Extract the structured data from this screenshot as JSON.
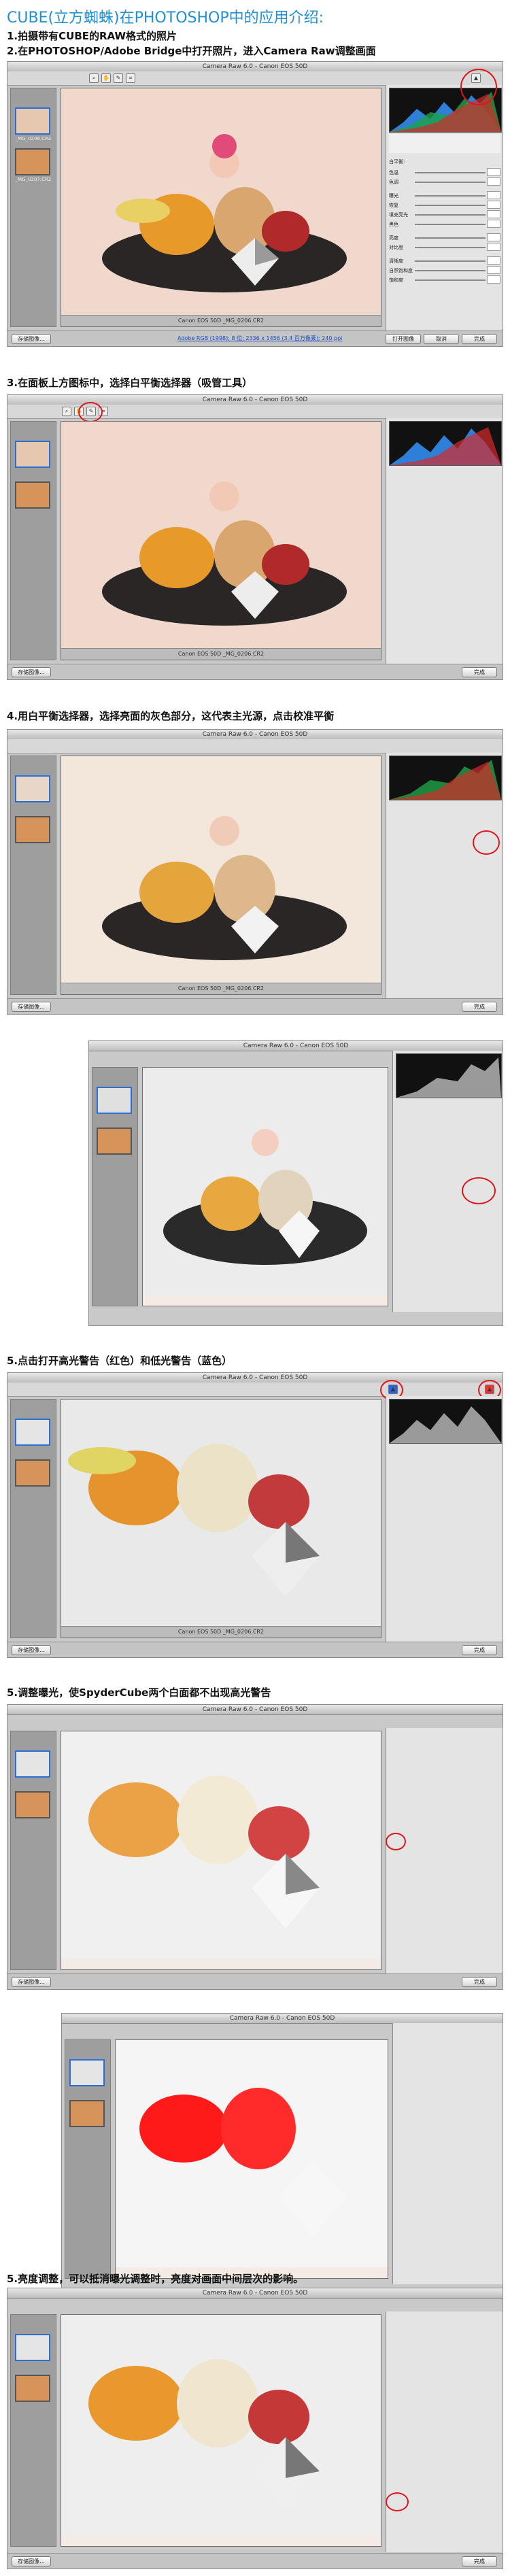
{
  "page_title": "CUBE(立方蜘蛛)在PHOTOSHOP中的应用介绍:",
  "steps": {
    "s1": "1.拍摄带有CUBE的RAW格式的照片",
    "s2": "2.在PHOTOSHOP/Adobe Bridge中打开照片，进入Camera Raw调整画面",
    "s3": "3.在面板上方图标中，选择白平衡选择器（吸管工具）",
    "s4": "4.用白平衡选择器，选择亮面的灰色部分，这代表主光源，点击校准平衡",
    "s5": "5.点击打开高光警告（红色）和低光警告（蓝色）",
    "s6": "5.调整曝光，使SpyderCube两个白面都不出现高光警告",
    "s7": "5.亮度调整，可以抵消曝光调整时，亮度对画面中间层次的影响。"
  },
  "window": {
    "title": "Camera Raw 6.0 - Canon EOS 50D",
    "status": "Canon EOS 50D   _MG_0206.CR2",
    "open_btn": "打开",
    "cancel_btn": "取消",
    "done_btn": "完成",
    "save_btn": "存储图像...",
    "open_image_btn": "打开图像",
    "workflow_link": "Adobe RGB (1998); 8 位; 2336 x 1456 (3.4 百万像素); 240 ppi",
    "zoom": "26.7%",
    "thumbs": [
      "_MG_0206.CR2",
      "_MG_0207.CR2"
    ],
    "select_all": "全选",
    "sync": "同步..."
  },
  "panel": {
    "wb_label": "白平衡:",
    "wb_value": "原照设置",
    "sliders": [
      "色温",
      "色调",
      "曝光",
      "恢复",
      "填充亮光",
      "黑色",
      "亮度",
      "对比度",
      "清晰度",
      "自然饱和度",
      "饱和度"
    ]
  },
  "colors": {
    "accent": "#1f8fd6",
    "circle": "#e0151b"
  }
}
